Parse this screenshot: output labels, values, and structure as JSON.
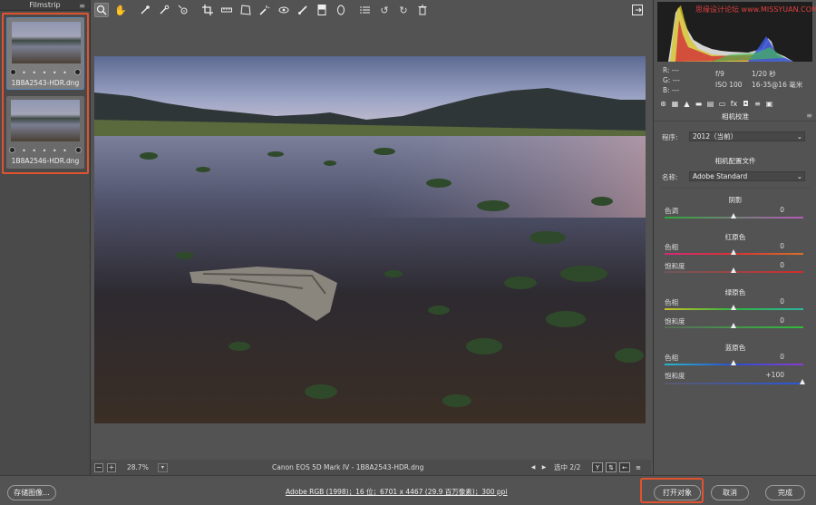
{
  "filmstrip": {
    "title": "Filmstrip",
    "items": [
      {
        "name": "1B8A2543-HDR.dng",
        "stars": "• • • • •"
      },
      {
        "name": "1B8A2546-HDR.dng",
        "stars": "• • • • •"
      }
    ]
  },
  "toolbar": {
    "tools": [
      "zoom-icon",
      "hand-icon",
      "white-balance-icon",
      "color-sampler-icon",
      "target-adjust-icon",
      "crop-icon",
      "straighten-icon",
      "transform-icon",
      "spot-removal-icon",
      "red-eye-icon",
      "adjustment-brush-icon",
      "graduated-filter-icon",
      "radial-filter-icon",
      "list-icon",
      "rotate-left-icon",
      "rotate-right-icon",
      "trash-icon"
    ],
    "fullscreen_icon": "fullscreen-icon"
  },
  "status": {
    "zoom": "28.7%",
    "camera": "Canon EOS 5D Mark IV  -  1B8A2543-HDR.dng",
    "selection": "选中 2/2",
    "view_y": "Y"
  },
  "bottom": {
    "save_label": "存储图像...",
    "workflow": "Adobe RGB (1998)；16 位；6701 x 4467 (29.9 百万像素)；300 ppi",
    "open_label": "打开对象",
    "cancel_label": "取消",
    "done_label": "完成"
  },
  "info": {
    "watermark": "思缘设计论坛  www.MISSYUAN.COM",
    "r": "R:   ---",
    "g": "G:   ---",
    "b": "B:   ---",
    "aperture": "f/9",
    "shutter": "1/20 秒",
    "iso": "ISO 100",
    "lens": "16-35@16 毫米"
  },
  "panel": {
    "title": "相机校准",
    "process_label": "程序:",
    "process_value": "2012（当前）",
    "profile_section": "相机配置文件",
    "name_label": "名称:",
    "name_value": "Adobe Standard",
    "shadows_title": "阴影",
    "tint_label": "色调",
    "tint_value": "0",
    "red_title": "红原色",
    "red_hue_label": "色相",
    "red_hue_value": "0",
    "red_sat_label": "饱和度",
    "red_sat_value": "0",
    "green_title": "绿原色",
    "green_hue_label": "色相",
    "green_hue_value": "0",
    "green_sat_label": "饱和度",
    "green_sat_value": "0",
    "blue_title": "蓝原色",
    "blue_hue_label": "色相",
    "blue_hue_value": "0",
    "blue_sat_label": "饱和度",
    "blue_sat_value": "+100"
  },
  "colors": {
    "highlight": "#e0532e",
    "background": "#535353"
  }
}
